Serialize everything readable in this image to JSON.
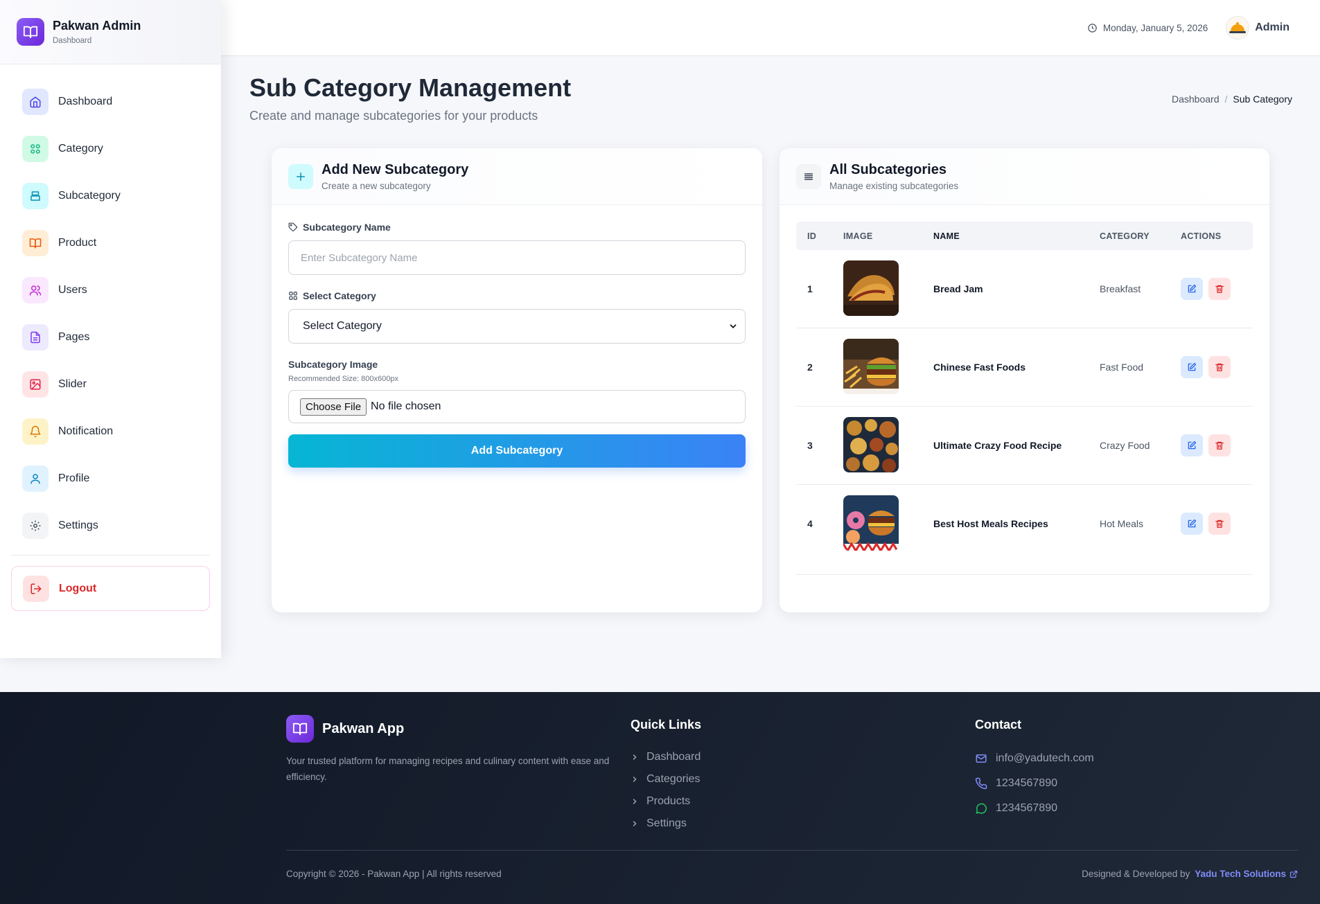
{
  "brand": {
    "title": "Pakwan Admin",
    "subtitle": "Dashboard"
  },
  "sidebar": {
    "items": [
      {
        "label": "Dashboard",
        "icon": "home-icon",
        "bg": "#e0e7ff",
        "color": "#4f46e5"
      },
      {
        "label": "Category",
        "icon": "grid-icon",
        "bg": "#d1fae5",
        "color": "#10b981"
      },
      {
        "label": "Subcategory",
        "icon": "layers-icon",
        "bg": "#cffafe",
        "color": "#0891b2"
      },
      {
        "label": "Product",
        "icon": "book-icon",
        "bg": "#ffedd5",
        "color": "#ea580c"
      },
      {
        "label": "Users",
        "icon": "users-icon",
        "bg": "#fae8ff",
        "color": "#c026d3"
      },
      {
        "label": "Pages",
        "icon": "file-icon",
        "bg": "#ede9fe",
        "color": "#7c3aed"
      },
      {
        "label": "Slider",
        "icon": "image-icon",
        "bg": "#ffe4e6",
        "color": "#e11d48"
      },
      {
        "label": "Notification",
        "icon": "bell-icon",
        "bg": "#fef3c7",
        "color": "#d97706"
      },
      {
        "label": "Profile",
        "icon": "user-icon",
        "bg": "#e0f2fe",
        "color": "#0284c7"
      },
      {
        "label": "Settings",
        "icon": "gear-icon",
        "bg": "#f3f4f6",
        "color": "#4b5563"
      }
    ],
    "logout": "Logout"
  },
  "topbar": {
    "date": "Monday, January 5, 2026",
    "user": "Admin"
  },
  "page": {
    "title": "Sub Category Management",
    "subtitle": "Create and manage subcategories for your products",
    "breadcrumb": [
      "Dashboard",
      "/",
      "Sub Category"
    ]
  },
  "form": {
    "title": "Add New Subcategory",
    "subtitle": "Create a new subcategory",
    "name_label": "Subcategory Name",
    "name_placeholder": "Enter Subcategory Name",
    "category_label": "Select Category",
    "category_value": "Select Category",
    "image_label": "Subcategory Image",
    "image_hint": "Recommended Size: 800x600px",
    "file_button": "Choose File",
    "file_status": "No file chosen",
    "submit": "Add Subcategory"
  },
  "list": {
    "title": "All Subcategories",
    "subtitle": "Manage existing subcategories",
    "columns": [
      "ID",
      "IMAGE",
      "NAME",
      "CATEGORY",
      "ACTIONS"
    ],
    "rows": [
      {
        "id": "1",
        "name": "Bread Jam",
        "category": "Breakfast"
      },
      {
        "id": "2",
        "name": "Chinese Fast Foods",
        "category": "Fast Food"
      },
      {
        "id": "3",
        "name": "Ultimate Crazy Food Recipe",
        "category": "Crazy Food"
      },
      {
        "id": "4",
        "name": "Best Host Meals Recipes",
        "category": "Hot Meals"
      }
    ]
  },
  "footer": {
    "brand": "Pakwan App",
    "description": "Your trusted platform for managing recipes and culinary content with ease and efficiency.",
    "quick_links_title": "Quick Links",
    "quick_links": [
      "Dashboard",
      "Categories",
      "Products",
      "Settings"
    ],
    "contact_title": "Contact",
    "email": "info@yadutech.com",
    "phone": "1234567890",
    "whatsapp": "1234567890",
    "copyright": "Copyright © 2026 - Pakwan App | All rights reserved",
    "designed_by": "Designed & Developed by",
    "company": "Yadu Tech Solutions"
  }
}
